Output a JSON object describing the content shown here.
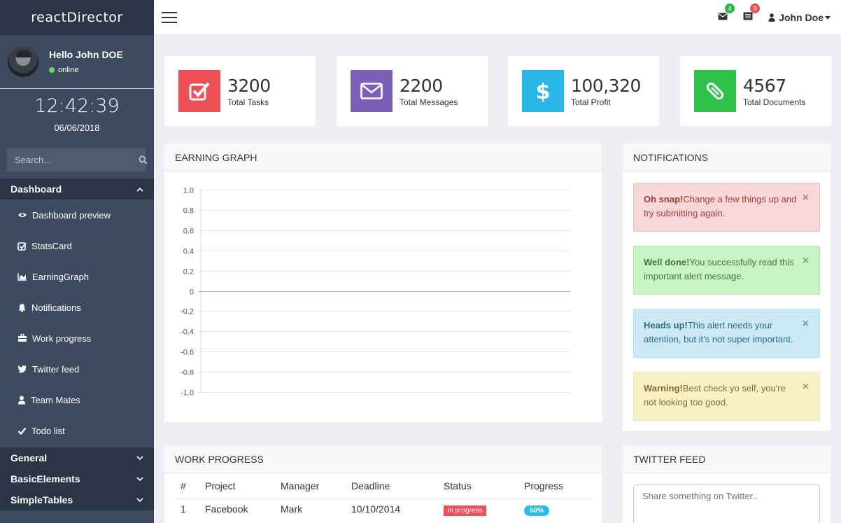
{
  "app": {
    "title": "reactDirector"
  },
  "user": {
    "greeting": "Hello John DOE",
    "status": "online",
    "menu_name": "John Doe"
  },
  "clock": {
    "time": "12:42:39",
    "date": "06/06/2018"
  },
  "search": {
    "placeholder": "Search..."
  },
  "sidebar": {
    "dashboard_label": "Dashboard",
    "items": [
      {
        "label": "Dashboard preview",
        "icon": "eye-icon"
      },
      {
        "label": "StatsCard",
        "icon": "check-square-icon"
      },
      {
        "label": "EarningGraph",
        "icon": "area-chart-icon"
      },
      {
        "label": "Notifications",
        "icon": "bell-icon"
      },
      {
        "label": "Work progress",
        "icon": "briefcase-icon"
      },
      {
        "label": "Twitter feed",
        "icon": "twitter-icon"
      },
      {
        "label": "Team Mates",
        "icon": "user-icon"
      },
      {
        "label": "Todo list",
        "icon": "check-icon"
      }
    ],
    "sections": [
      "General",
      "BasicElements",
      "SimpleTables"
    ]
  },
  "topbar": {
    "messages_count": "4",
    "tasks_count": "9"
  },
  "stats": [
    {
      "value": "3200",
      "label": "Total Tasks",
      "color": "#ed5056",
      "icon": "check-square-icon"
    },
    {
      "value": "2200",
      "label": "Total Messages",
      "color": "#7b5fb8",
      "icon": "envelope-icon"
    },
    {
      "value": "100,320",
      "label": "Total Profit",
      "color": "#28b7e7",
      "icon": "dollar-icon"
    },
    {
      "value": "4567",
      "label": "Total Documents",
      "color": "#2ec24b",
      "icon": "paperclip-icon"
    }
  ],
  "earning": {
    "title": "EARNING GRAPH",
    "chart_data": {
      "type": "line",
      "title": "",
      "xlabel": "",
      "ylabel": "",
      "ylim": [
        -1.0,
        1.0
      ],
      "yticks": [
        "1.0",
        "0.8",
        "0.6",
        "0.4",
        "0.2",
        "0",
        "-0.2",
        "-0.4",
        "-0.6",
        "-0.8",
        "-1.0"
      ],
      "series": []
    }
  },
  "notifications": {
    "title": "NOTIFICATIONS",
    "alerts": [
      {
        "strong": "Oh snap!",
        "text": "Change a few things up and try submitting again.",
        "type": "danger"
      },
      {
        "strong": "Well done!",
        "text": "You successfully read this important alert message.",
        "type": "success"
      },
      {
        "strong": "Heads up!",
        "text": "This alert needs your attention, but it's not super important.",
        "type": "info"
      },
      {
        "strong": "Warning!",
        "text": "Best check yo self, you're not looking too good.",
        "type": "warning"
      }
    ],
    "close_glyph": "×"
  },
  "work_progress": {
    "title": "WORK PROGRESS",
    "columns": [
      "#",
      "Project",
      "Manager",
      "Deadline",
      "Status",
      "Progress"
    ],
    "rows": [
      {
        "num": "1",
        "project": "Facebook",
        "manager": "Mark",
        "deadline": "10/10/2014",
        "status": "in progress",
        "progress": "50%"
      }
    ]
  },
  "twitter": {
    "title": "TWITTER FEED",
    "placeholder": "Share something on Twitter.."
  }
}
